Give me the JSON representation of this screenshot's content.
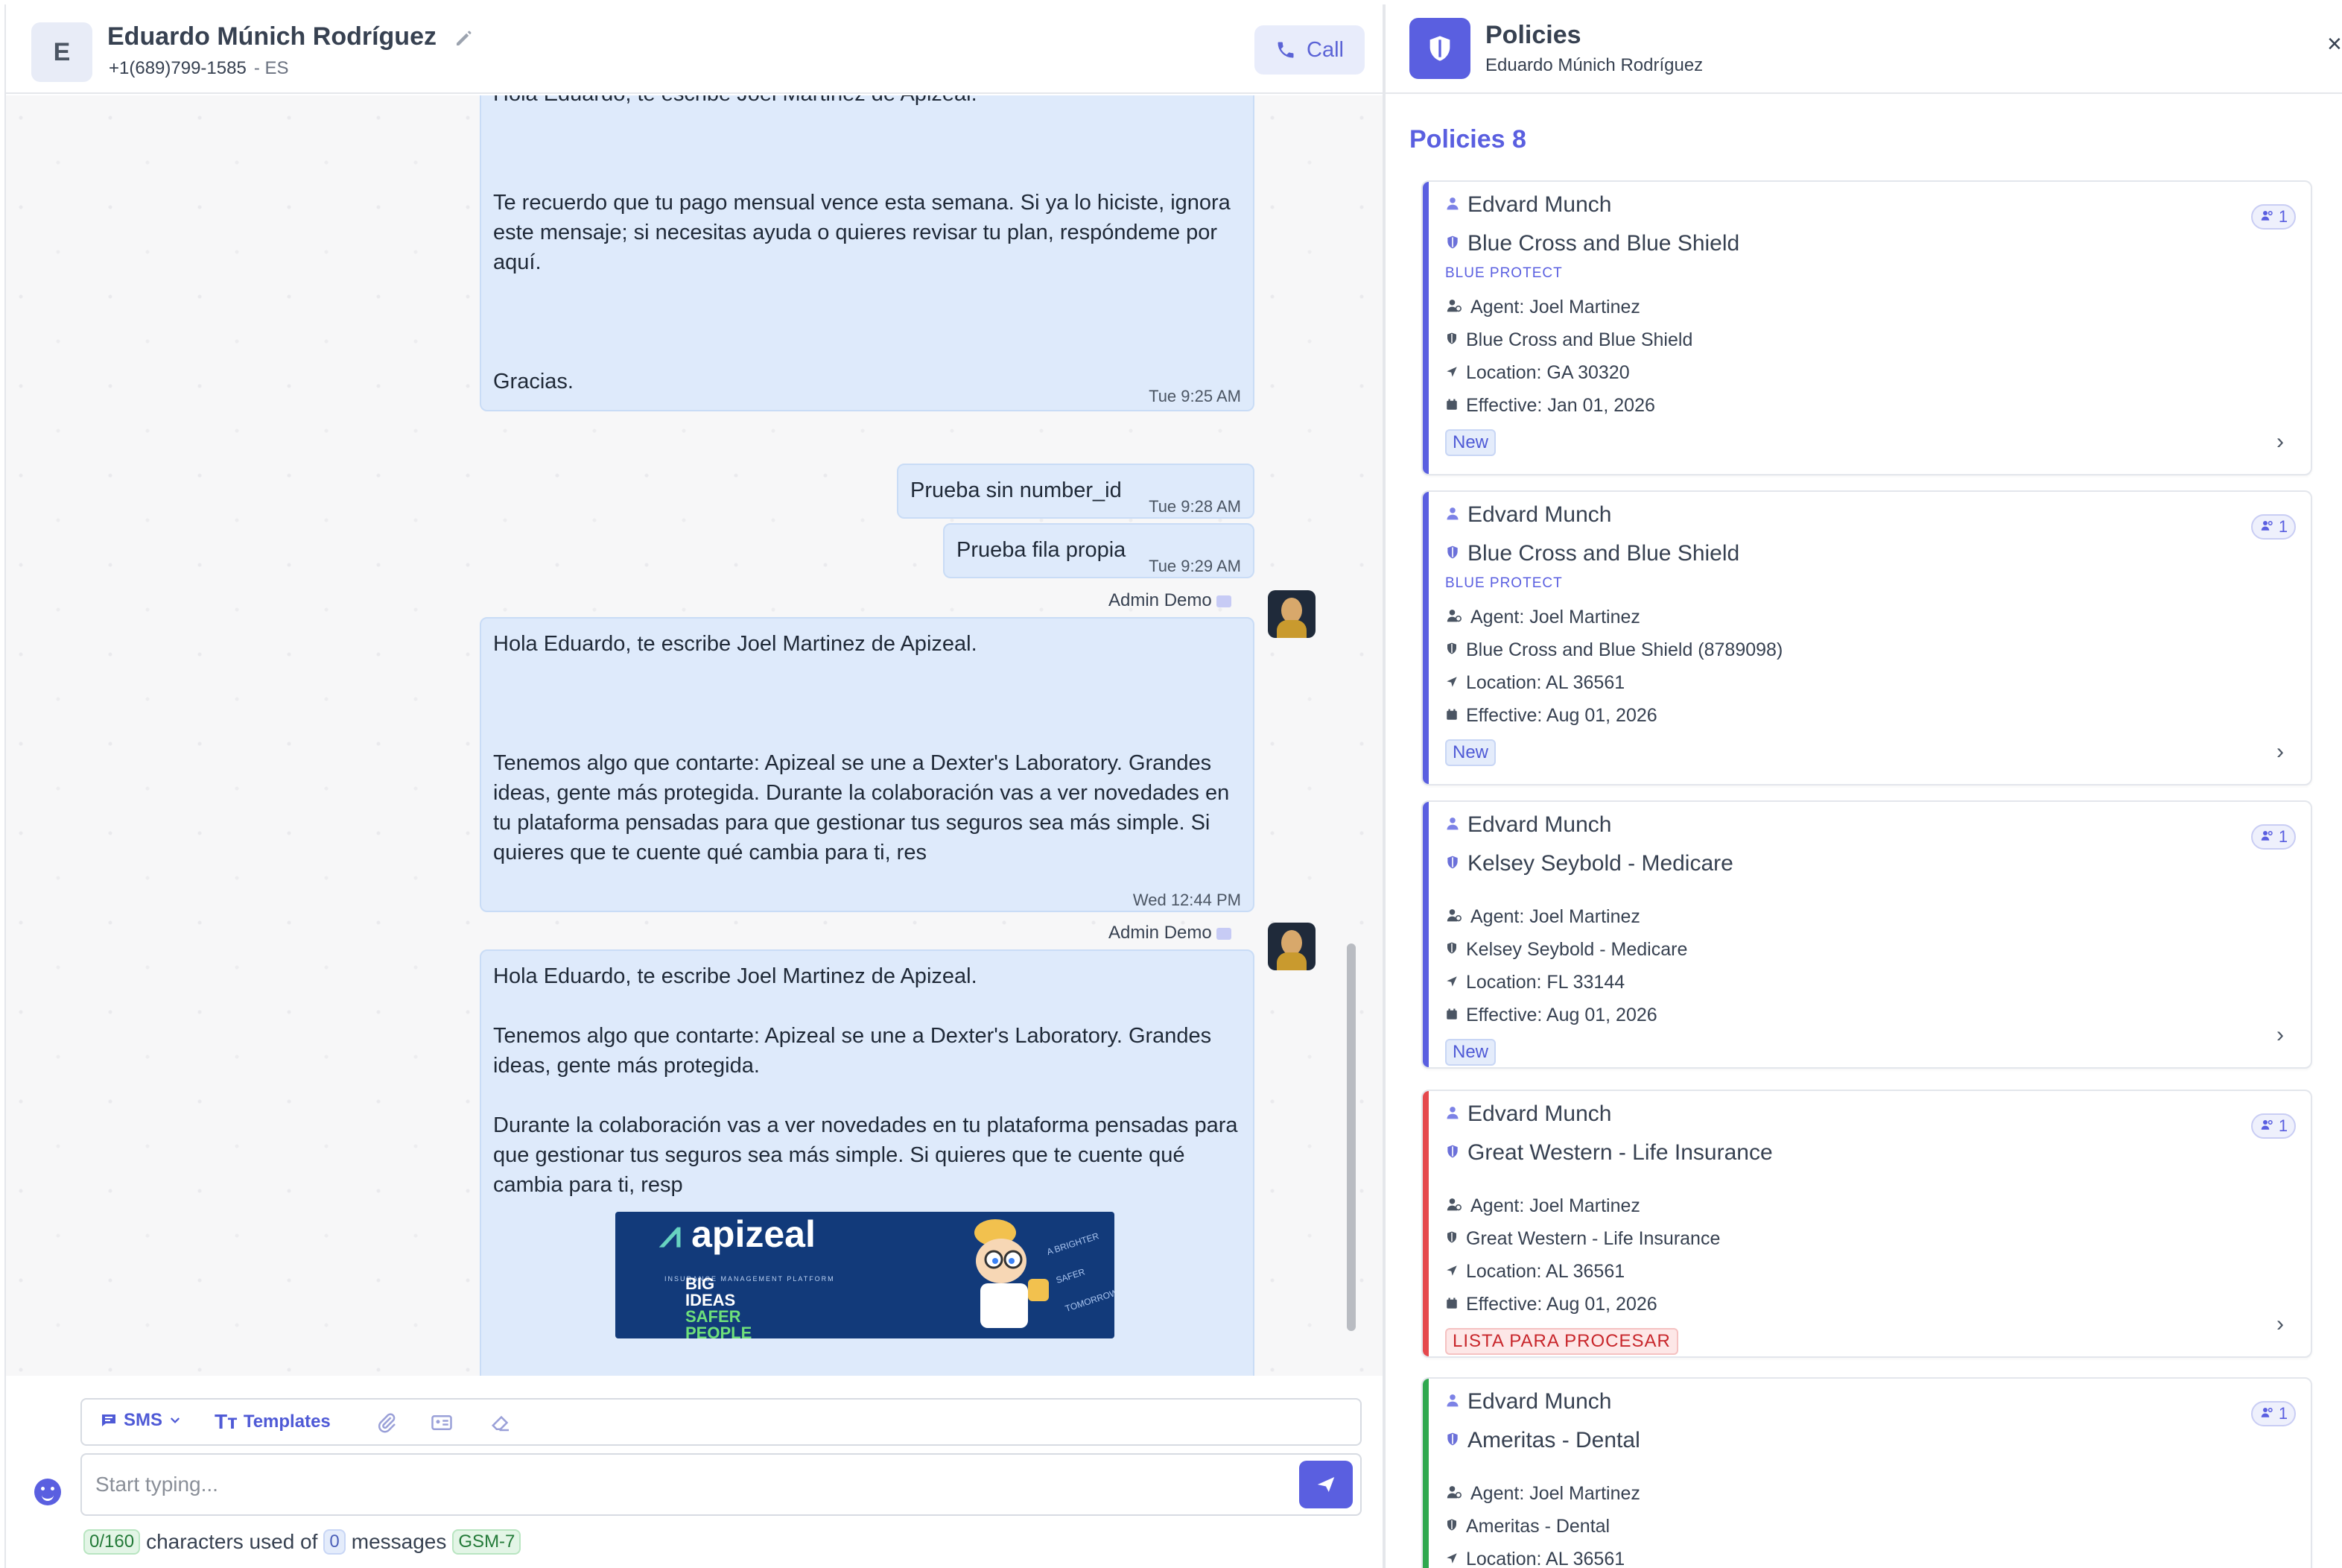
{
  "contact": {
    "initial": "E",
    "name": "Eduardo Múnich Rodríguez",
    "phone": "+1(689)799-1585",
    "lang": "- ES",
    "call_label": "Call"
  },
  "messages": [
    {
      "text_top": "Hola Eduardo, te escribe Joel Martinez de Apizeal.",
      "text": "Te recuerdo que tu pago mensual vence esta semana. Si ya lo hiciste, ignora este mensaje; si necesitas ayuda o quieres revisar tu plan, respóndeme por aquí.\n\n\n\nGracias.",
      "time": "Tue 9:25 AM"
    },
    {
      "text": "Prueba sin number_id",
      "time": "Tue 9:28 AM"
    },
    {
      "text": "Prueba fila propia",
      "time": "Tue 9:29 AM"
    },
    {
      "sender": "Admin Demo",
      "text": "Hola Eduardo, te escribe Joel Martinez de Apizeal.\n\n\n\nTenemos algo que contarte: Apizeal se une a Dexter's Laboratory. Grandes ideas, gente más protegida. Durante la colaboración vas a ver novedades en tu plataforma pensadas para que gestionar tus seguros sea más simple. Si quieres que te cuente qué cambia para ti, res",
      "time": "Wed 12:44 PM"
    },
    {
      "sender": "Admin Demo",
      "text": "Hola Eduardo, te escribe Joel Martinez de Apizeal.\n\nTenemos algo que contarte: Apizeal se une a Dexter's Laboratory. Grandes ideas, gente más protegida.\n\nDurante la colaboración vas a ver novedades en tu plataforma pensadas para que gestionar tus seguros sea más simple. Si quieres que te cuente qué cambia para ti, resp",
      "banner": {
        "logo": "apizeal",
        "sub": "INSURANCE MANAGEMENT PLATFORM",
        "big1": "BIG",
        "big2": "IDEAS",
        "big3": "SAFER",
        "big4": "PEOPLE",
        "tag": "A BRIGHTER SAFER TOMORROW"
      }
    }
  ],
  "composer": {
    "channel": "SMS",
    "templates": "Templates",
    "placeholder": "Start typing...",
    "count": "0/160",
    "chars_text": "characters used of",
    "msg_count": "0",
    "msg_text": "messages",
    "encoding": "GSM-7"
  },
  "policies": {
    "title": "Policies",
    "subtitle": "Eduardo Múnich Rodríguez",
    "close": "×",
    "count_label": "Policies 8",
    "cards": [
      {
        "holder": "Edvard Munch",
        "carrier": "Blue Cross and Blue Shield",
        "product": "BLUE PROTECT",
        "agent": "Agent: Joel Martinez",
        "carrier_line": "Blue Cross and Blue Shield",
        "location": "Location: GA 30320",
        "effective": "Effective: Jan 01, 2026",
        "status": "New",
        "members": "1",
        "accent": "#5a5fe0"
      },
      {
        "holder": "Edvard Munch",
        "carrier": "Blue Cross and Blue Shield",
        "product": "BLUE PROTECT",
        "agent": "Agent: Joel Martinez",
        "carrier_line": "Blue Cross and Blue Shield (8789098)",
        "location": "Location: AL 36561",
        "effective": "Effective: Aug 01, 2026",
        "status": "New",
        "members": "1",
        "accent": "#5a5fe0"
      },
      {
        "holder": "Edvard Munch",
        "carrier": "Kelsey Seybold - Medicare",
        "product": "",
        "agent": "Agent: Joel Martinez",
        "carrier_line": "Kelsey Seybold - Medicare",
        "location": "Location: FL 33144",
        "effective": "Effective: Aug 01, 2026",
        "status": "New",
        "members": "1",
        "accent": "#5a5fe0"
      },
      {
        "holder": "Edvard Munch",
        "carrier": "Great Western - Life Insurance",
        "product": "",
        "agent": "Agent: Joel Martinez",
        "carrier_line": "Great Western - Life Insurance",
        "location": "Location: AL 36561",
        "effective": "Effective: Aug 01, 2026",
        "status": "LISTA PARA PROCESAR",
        "members": "1",
        "accent": "#e5484d"
      },
      {
        "holder": "Edvard Munch",
        "carrier": "Ameritas - Dental",
        "product": "",
        "agent": "Agent: Joel Martinez",
        "carrier_line": "Ameritas - Dental",
        "location": "Location: AL 36561",
        "effective": "",
        "status": "",
        "members": "1",
        "accent": "#2fa84f"
      }
    ]
  }
}
